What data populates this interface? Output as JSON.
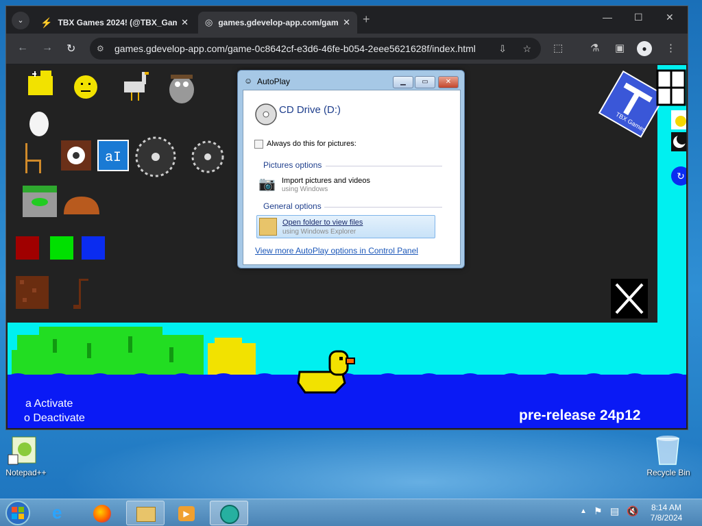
{
  "browser": {
    "tabs": [
      {
        "label": "TBX Games 2024! (@TBX_Gam",
        "icon": "bolt-icon"
      },
      {
        "label": "games.gdevelop-app.com/gam",
        "icon": "globe-icon"
      }
    ],
    "url": "games.gdevelop-app.com/game-0c8642cf-e3d6-46fe-b054-2eee5621628f/index.html"
  },
  "game": {
    "activate_hint": "a Activate",
    "deactivate_hint": "o Deactivate",
    "release_label": "pre-release 24p12",
    "logo_text": "TBX Games",
    "text_tool_label": "aI"
  },
  "autoplay": {
    "title": "AutoPlay",
    "drive_label": "CD Drive (D:)",
    "always_label": "Always do this for pictures:",
    "pictures_section": "Pictures options",
    "import_label": "Import pictures and videos",
    "import_sub": "using Windows",
    "general_section": "General options",
    "open_folder_label": "Open folder to view files",
    "open_folder_sub": "using Windows Explorer",
    "more_link": "View more AutoPlay options in Control Panel"
  },
  "desktop": {
    "notepad_label": "Notepad++",
    "recycle_label": "Recycle Bin"
  },
  "taskbar": {
    "time": "8:14 AM",
    "date": "7/8/2024"
  },
  "colors": {
    "game_sky": "#00f0f0",
    "water": "#0a1af5",
    "palette_bg": "#222222",
    "grass": "#22dd22"
  }
}
